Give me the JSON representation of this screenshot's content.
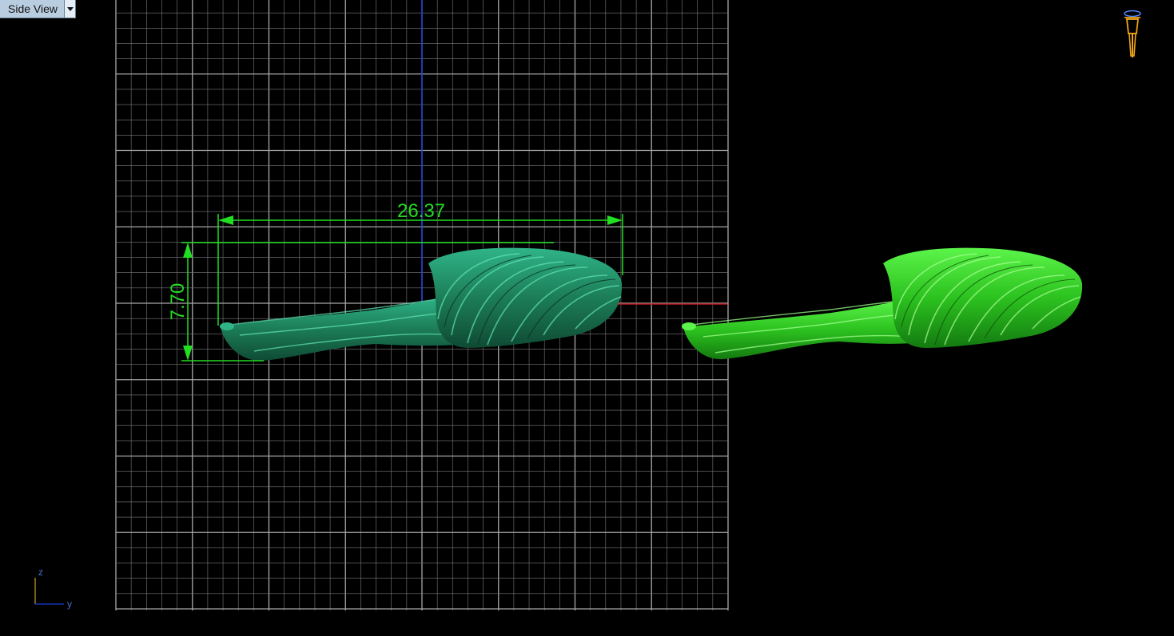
{
  "viewport": {
    "view_name": "Side View",
    "background": "#000000",
    "grid_color": "#7a7a7a",
    "major_grid_color": "#a8a8a8"
  },
  "dimensions": {
    "width_label": "26.37",
    "height_label": "7.70",
    "color": "#22dd22"
  },
  "axes": {
    "z_label": "z",
    "y_label": "y",
    "vertical_axis_color": "#1a3fd8",
    "horizontal_axis_color": "#c01515"
  },
  "models": {
    "primary_color": "#1f8f63",
    "secondary_color": "#2fd22a"
  },
  "icons": {
    "camera": "camera-icon",
    "view_menu": "chevron-down-icon"
  }
}
